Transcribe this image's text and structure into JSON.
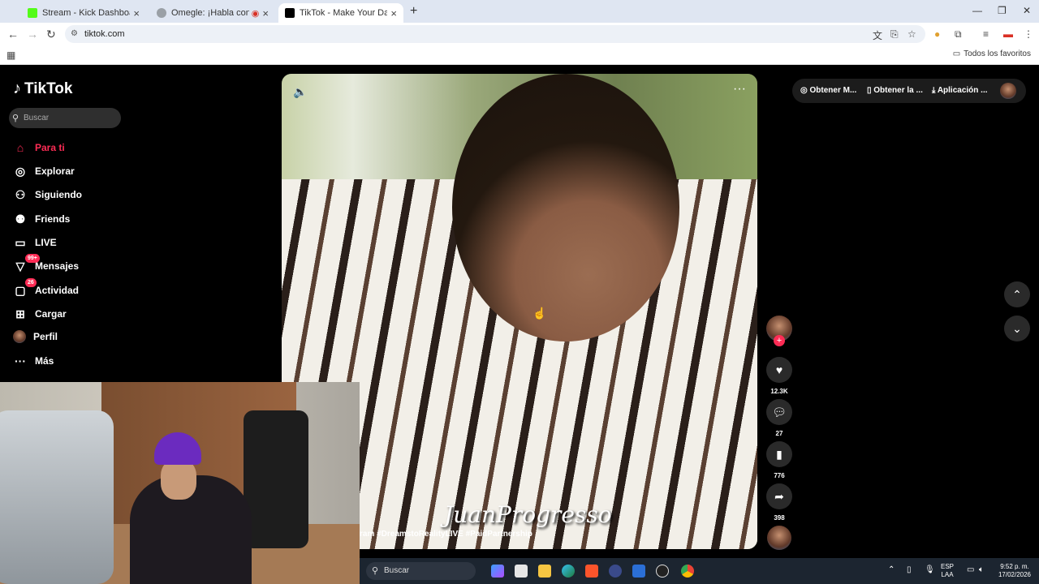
{
  "browser": {
    "tabs": [
      {
        "label": "Stream - Kick Dashboard",
        "favicon_color": "#53fc18"
      },
      {
        "label": "Omegle: ¡Habla con Descon",
        "favicon_color": "#9aa0a6"
      },
      {
        "label": "TikTok - Make Your Day",
        "favicon_color": "#000000"
      }
    ],
    "new_tab": "+",
    "url": "tiktok.com",
    "bookmarks_folder": "Todos los favoritos"
  },
  "tiktok": {
    "logo": "TikTok",
    "search_placeholder": "Buscar",
    "nav": [
      {
        "label": "Para ti",
        "icon": "home-icon",
        "glyph": "⌂",
        "active": true
      },
      {
        "label": "Explorar",
        "icon": "compass-icon",
        "glyph": "◎"
      },
      {
        "label": "Siguiendo",
        "icon": "following-icon",
        "glyph": "👤"
      },
      {
        "label": "Friends",
        "icon": "friends-icon",
        "glyph": "👥"
      },
      {
        "label": "LIVE",
        "icon": "live-icon",
        "glyph": "▭"
      },
      {
        "label": "Mensajes",
        "icon": "messages-icon",
        "glyph": "▽",
        "badge": "99+"
      },
      {
        "label": "Actividad",
        "icon": "activity-icon",
        "glyph": "▢",
        "badge": "26"
      },
      {
        "label": "Cargar",
        "icon": "upload-icon",
        "glyph": "⊞"
      },
      {
        "label": "Perfil",
        "icon": "profile-avatar",
        "glyph": "●"
      },
      {
        "label": "Más",
        "icon": "more-icon",
        "glyph": "···"
      }
    ],
    "top_buttons": {
      "coins": "Obtener M...",
      "app": "Obtener la ...",
      "desktop": "Aplicación ..."
    },
    "video": {
      "overlay_text": "JuanProgresso",
      "hashtags": "ram #DreamstoRealityLIVE #PaidPartnership"
    },
    "actions": {
      "likes": "12.3K",
      "comments": "27",
      "saves": "776",
      "shares": "398"
    },
    "accent_color": "#fe2c55"
  },
  "taskbar": {
    "search": "Buscar",
    "lang": "ESP",
    "lang_sub": "LAA",
    "time": "9:52 p. m.",
    "date": "17/02/2026"
  }
}
